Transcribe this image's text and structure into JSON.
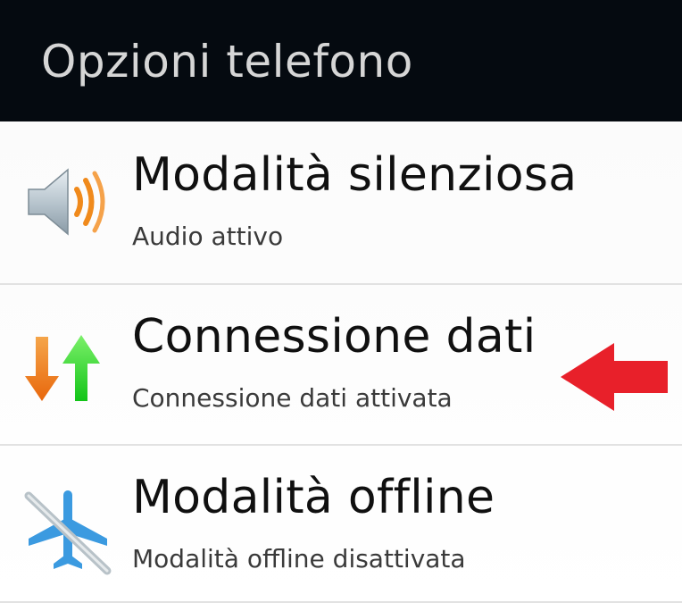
{
  "header": {
    "title": "Opzioni telefono"
  },
  "items": [
    {
      "title": "Modalità silenziosa",
      "subtitle": "Audio attivo",
      "icon": "speaker-icon"
    },
    {
      "title": "Connessione dati",
      "subtitle": "Connessione dati attivata",
      "icon": "data-transfer-arrows-icon"
    },
    {
      "title": "Modalità offline",
      "subtitle": "Modalità offline disattivata",
      "icon": "airplane-disabled-icon"
    }
  ],
  "annotation": {
    "icon": "red-pointer-arrow",
    "color": "#e8202a"
  },
  "colors": {
    "header_bg": "#050a10",
    "header_text": "#d6d6d6",
    "list_bg": "#ffffff",
    "title_text": "#101010",
    "subtitle_text": "#3a3a3a",
    "speaker_waves": "#f08a1c",
    "arrow_down": "#f07a18",
    "arrow_up": "#22d22a",
    "airplane": "#3b9ae0"
  }
}
